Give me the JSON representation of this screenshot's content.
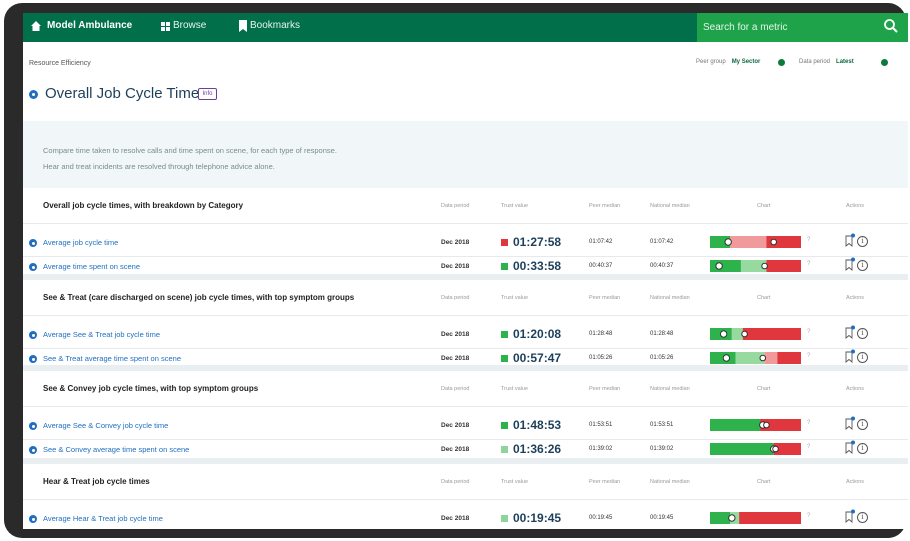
{
  "app": {
    "brand": "Model Ambulance",
    "nav_browse": "Browse",
    "nav_bookmarks": "Bookmarks",
    "search_placeholder": "Search for a metric",
    "colors": {
      "nav_bg": "#01704a",
      "search_bg": "#1fa34a",
      "good": "#2eb24c",
      "bad": "#e0363d",
      "link": "#1f6fc1"
    }
  },
  "header": {
    "breadcrumb": "Resource Efficiency",
    "peer_group_label": "Peer group",
    "peer_group_value": "My Sector",
    "data_period_label": "Data period",
    "data_period_value": "Latest"
  },
  "page": {
    "title": "Overall Job Cycle Time",
    "info_badge": "Info",
    "description_line1": "Compare time taken to resolve calls and time spent on scene, for each type of response.",
    "description_line2": "Hear and treat incidents are resolved through telephone advice alone."
  },
  "columns": {
    "data_period": "Data period",
    "trust_value": "Trust value",
    "peer_median": "Peer median",
    "national_median": "National median",
    "chart": "Chart",
    "actions": "Actions"
  },
  "sections": [
    {
      "title": "Overall job cycle times, with breakdown by Category",
      "rows": [
        {
          "label": "Average job cycle time",
          "period": "Dec 2018",
          "trust_value": "01:27:58",
          "status": "bad",
          "peer": "01:07:42",
          "national": "01:07:42",
          "chart": {
            "green": 0.22,
            "lightgreen": 0.0,
            "lightred": 0.4,
            "red": 0.38,
            "marker": 0.2,
            "trust": 0.7
          }
        },
        {
          "label": "Average time spent on scene",
          "period": "Dec 2018",
          "trust_value": "00:33:58",
          "status": "good",
          "peer": "00:40:37",
          "national": "00:40:37",
          "chart": {
            "green": 0.34,
            "lightgreen": 0.28,
            "lightred": 0.0,
            "red": 0.38,
            "marker": 0.1,
            "trust": 0.6
          }
        }
      ]
    },
    {
      "title": "See & Treat (care discharged on scene) job cycle times, with top symptom groups",
      "rows": [
        {
          "label": "Average See & Treat job cycle time",
          "period": "Dec 2018",
          "trust_value": "01:20:08",
          "status": "good",
          "peer": "01:28:48",
          "national": "01:28:48",
          "chart": {
            "green": 0.24,
            "lightgreen": 0.12,
            "lightred": 0.0,
            "red": 0.64,
            "marker": 0.15,
            "trust": 0.38
          }
        },
        {
          "label": "See & Treat average time spent on scene",
          "period": "Dec 2018",
          "trust_value": "00:57:47",
          "status": "good",
          "peer": "01:05:26",
          "national": "01:05:26",
          "chart": {
            "green": 0.28,
            "lightgreen": 0.32,
            "lightred": 0.14,
            "red": 0.26,
            "marker": 0.18,
            "trust": 0.58
          }
        }
      ]
    },
    {
      "title": "See & Convey job cycle times, with top symptom groups",
      "rows": [
        {
          "label": "Average See & Convey job cycle time",
          "period": "Dec 2018",
          "trust_value": "01:48:53",
          "status": "good",
          "peer": "01:53:51",
          "national": "01:53:51",
          "chart": {
            "green": 0.55,
            "lightgreen": 0.0,
            "lightred": 0.0,
            "red": 0.45,
            "marker": 0.58,
            "trust": 0.62
          }
        },
        {
          "label": "See & Convey average time spent on scene",
          "period": "Dec 2018",
          "trust_value": "01:36:26",
          "status": "lightgood",
          "peer": "01:39:02",
          "national": "01:39:02",
          "chart": {
            "green": 0.7,
            "lightgreen": 0.0,
            "lightred": 0.0,
            "red": 0.3,
            "marker": 0.7,
            "trust": 0.72
          }
        }
      ]
    },
    {
      "title": "Hear & Treat job cycle times",
      "rows": [
        {
          "label": "Average Hear & Treat job cycle time",
          "period": "Dec 2018",
          "trust_value": "00:19:45",
          "status": "lightgood",
          "peer": "00:19:45",
          "national": "00:19:45",
          "chart": {
            "green": 0.22,
            "lightgreen": 0.1,
            "lightred": 0.0,
            "red": 0.68,
            "marker": 0.24,
            "trust": 0.0
          }
        }
      ]
    }
  ]
}
